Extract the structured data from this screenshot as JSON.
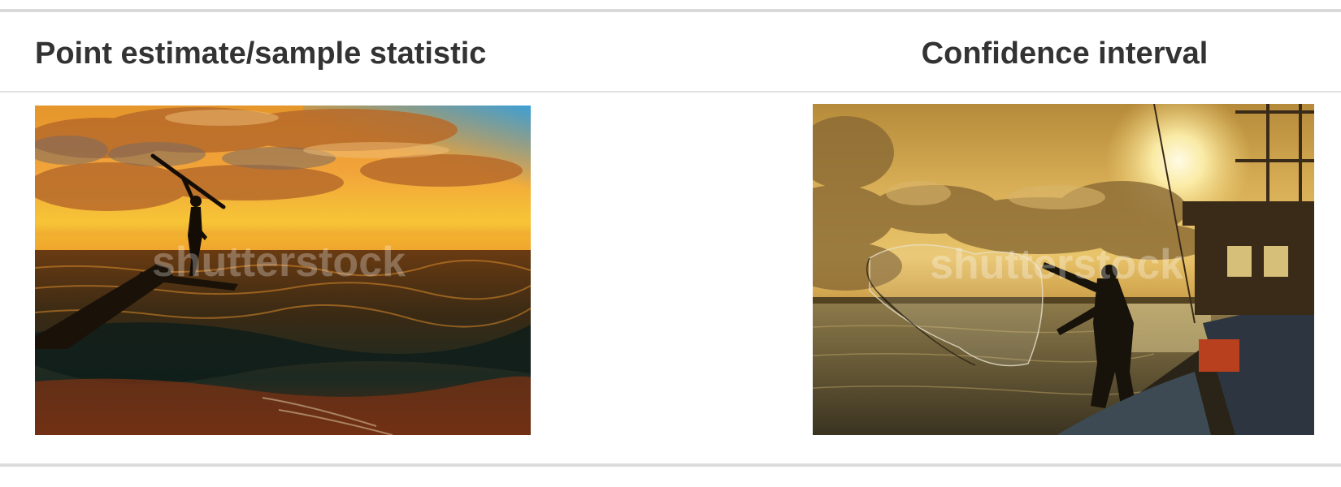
{
  "columns": [
    {
      "header": "Point estimate/sample statistic",
      "image": {
        "watermark": "shutterstock",
        "subject": "silhouette-person-on-driftwood-sunset-sea"
      }
    },
    {
      "header": "Confidence interval",
      "image": {
        "watermark": "shutterstock",
        "subject": "fisherman-casting-net-from-boat-at-sunset"
      }
    }
  ],
  "colors": {
    "header_text": "#333333",
    "rule": "#d9d9d9"
  }
}
